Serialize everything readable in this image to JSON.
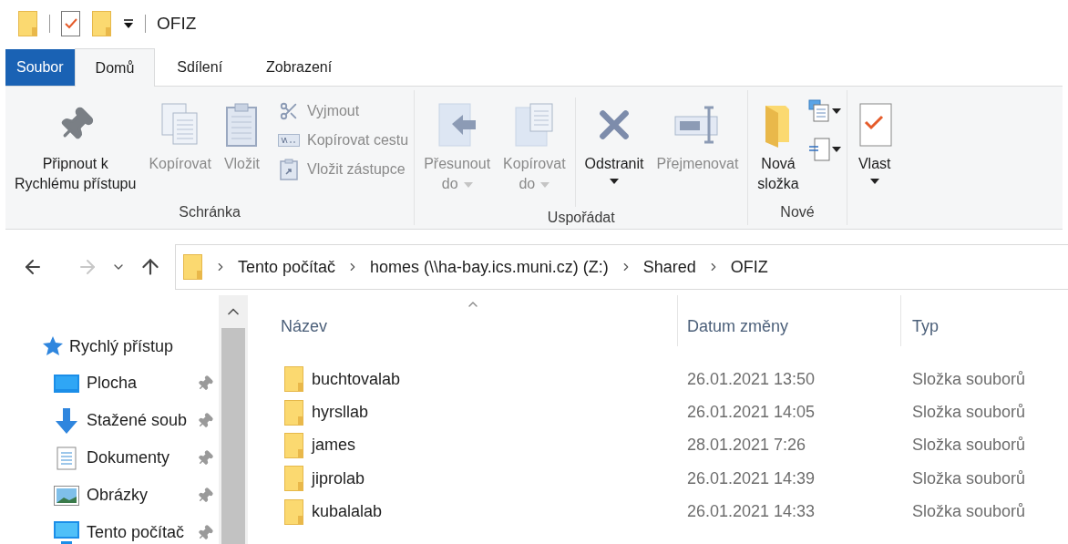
{
  "window": {
    "title": "OFIZ"
  },
  "tabs": [
    {
      "label": "Soubor",
      "kind": "file",
      "selected": false
    },
    {
      "label": "Domů",
      "kind": "tab",
      "selected": true
    },
    {
      "label": "Sdílení",
      "kind": "tab",
      "selected": false
    },
    {
      "label": "Zobrazení",
      "kind": "tab",
      "selected": false
    }
  ],
  "ribbon": {
    "groups": [
      {
        "label": "Schránka",
        "items": [
          {
            "kind": "large",
            "label": "Připnout k\nRychlému přístupu",
            "disabled": false
          },
          {
            "kind": "large",
            "label": "Kopírovat",
            "disabled": true
          },
          {
            "kind": "large",
            "label": "Vložit",
            "disabled": true
          },
          {
            "kind": "stack",
            "children": [
              {
                "label": "Vyjmout",
                "disabled": true
              },
              {
                "label": "Kopírovat cestu",
                "disabled": true
              },
              {
                "label": "Vložit zástupce",
                "disabled": true
              }
            ]
          }
        ]
      },
      {
        "label": "Uspořádat",
        "items": [
          {
            "kind": "large",
            "label": "Přesunout\ndo",
            "dropdown": true,
            "disabled": true
          },
          {
            "kind": "large",
            "label": "Kopírovat\ndo",
            "dropdown": true,
            "disabled": true
          },
          {
            "kind": "separator"
          },
          {
            "kind": "large",
            "label": "Odstranit",
            "dropdown": true,
            "disabled": false
          },
          {
            "kind": "large",
            "label": "Přejmenovat",
            "disabled": true
          }
        ]
      },
      {
        "label": "Nové",
        "items": [
          {
            "kind": "large",
            "label": "Nová\nsložka",
            "disabled": false
          },
          {
            "kind": "icons",
            "children": [
              {
                "dropdown": true,
                "disabled": false
              },
              {
                "dropdown": true,
                "disabled": false
              }
            ]
          }
        ]
      },
      {
        "items": [
          {
            "kind": "large",
            "label": "Vlast",
            "dropdown": true,
            "disabled": false
          }
        ]
      }
    ]
  },
  "navigation": {
    "back_disabled": false,
    "forward_disabled": true
  },
  "address": {
    "path": [
      "Tento počítač",
      "homes (\\\\ha-bay.ics.muni.cz) (Z:)",
      "Shared",
      "OFIZ"
    ]
  },
  "sidebar": {
    "items": [
      {
        "label": "Rychlý přístup",
        "children": [
          {
            "label": "Plocha",
            "pinned": true
          },
          {
            "label": "Stažené soub",
            "pinned": true
          },
          {
            "label": "Dokumenty",
            "pinned": true
          },
          {
            "label": "Obrázky",
            "pinned": true
          },
          {
            "label": "Tento počítač",
            "pinned": true
          }
        ]
      }
    ]
  },
  "table": {
    "columns": [
      {
        "label": "Název",
        "sorted": true
      },
      {
        "label": "Datum změny",
        "sorted": false
      },
      {
        "label": "Typ",
        "sorted": false
      }
    ],
    "rows": [
      {
        "name": "buchtovalab",
        "date": "26.01.2021 13:50",
        "type": "Složka souborů"
      },
      {
        "name": "hyrsllab",
        "date": "26.01.2021 14:05",
        "type": "Složka souborů"
      },
      {
        "name": "james",
        "date": "28.01.2021 7:26",
        "type": "Složka souborů"
      },
      {
        "name": "jiprolab",
        "date": "26.01.2021 14:39",
        "type": "Složka souborů"
      },
      {
        "name": "kubalalab",
        "date": "26.01.2021 14:33",
        "type": "Složka souborů"
      }
    ]
  }
}
